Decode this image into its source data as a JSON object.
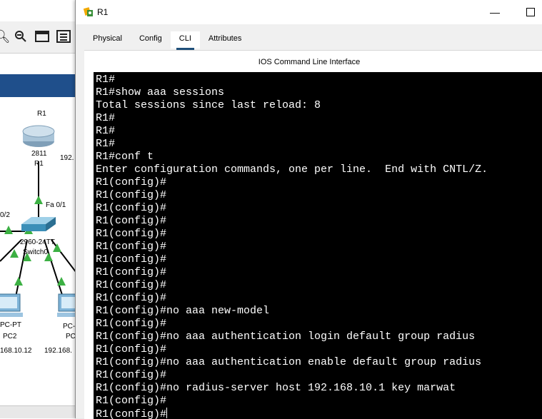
{
  "background": {
    "toolbar_icons": [
      "zoom-in-icon",
      "zoom-out-icon",
      "window-icon",
      "list-icon"
    ],
    "devices": {
      "router_name": "R1",
      "router_model": "2811",
      "router_label": "R1",
      "router_ip": "192.",
      "router_port": "Fa 0/1",
      "switch_port": "0/2",
      "switch_model": "2960-24TT",
      "switch_name": "Switch0",
      "pc1_type": "PC-PT",
      "pc1_name": "PC2",
      "pc1_ip": "168.10.12",
      "pc2_type": "PC-",
      "pc2_name": "PC",
      "pc2_ip": "192.168."
    }
  },
  "window": {
    "title": "R1",
    "minimize_glyph": "—",
    "tabs": [
      {
        "label": "Physical",
        "active": false
      },
      {
        "label": "Config",
        "active": false
      },
      {
        "label": "CLI",
        "active": true
      },
      {
        "label": "Attributes",
        "active": false
      }
    ],
    "section_title": "IOS Command Line Interface"
  },
  "terminal": {
    "lines": [
      "R1#",
      "R1#show aaa sessions",
      "Total sessions since last reload: 8",
      "R1#",
      "R1#",
      "R1#",
      "R1#conf t",
      "Enter configuration commands, one per line.  End with CNTL/Z.",
      "R1(config)#",
      "R1(config)#",
      "R1(config)#",
      "R1(config)#",
      "R1(config)#",
      "R1(config)#",
      "R1(config)#",
      "R1(config)#",
      "R1(config)#",
      "R1(config)#",
      "R1(config)#no aaa new-model",
      "R1(config)#",
      "R1(config)#no aaa authentication login default group radius",
      "R1(config)#",
      "R1(config)#no aaa authentication enable default group radius",
      "R1(config)#",
      "R1(config)#no radius-server host 192.168.10.1 key marwat",
      "R1(config)#"
    ],
    "prompt": "R1(config)#"
  },
  "colors": {
    "terminal_bg": "#000000",
    "terminal_fg": "#ffffff",
    "active_tab_underline": "#1f4f7a",
    "link_green": "#3cb043"
  }
}
